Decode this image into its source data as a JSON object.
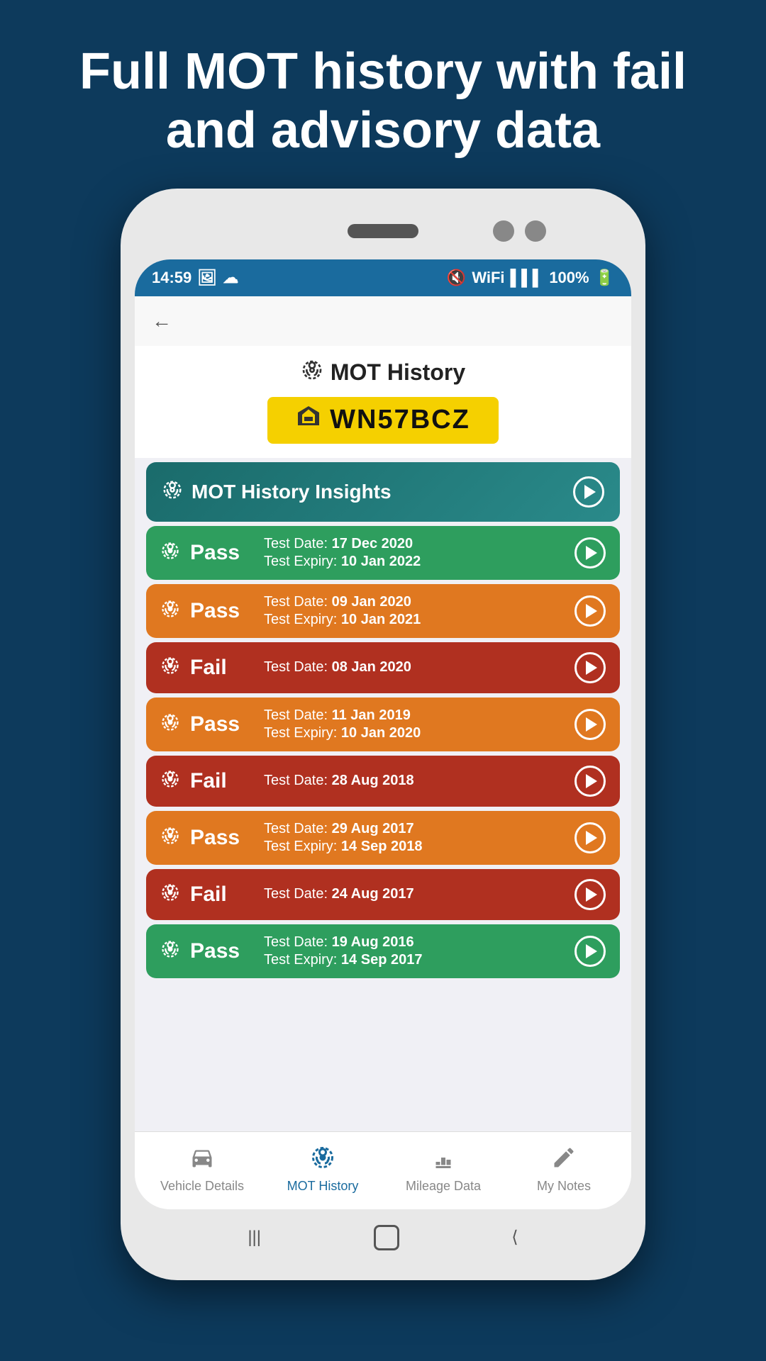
{
  "page": {
    "header": "Full MOT history with fail and advisory data"
  },
  "status_bar": {
    "time": "14:59",
    "battery": "100%"
  },
  "mot_title": "MOT History",
  "license_plate": "WN57BCZ",
  "insights": {
    "label": "MOT History Insights"
  },
  "records": [
    {
      "type": "Pass",
      "color_class": "pass-green",
      "test_date_label": "Test Date:",
      "test_date": "17 Dec 2020",
      "expiry_label": "Test Expiry:",
      "expiry": "10 Jan 2022",
      "has_expiry": true
    },
    {
      "type": "Pass",
      "color_class": "pass-orange",
      "test_date_label": "Test Date:",
      "test_date": "09 Jan 2020",
      "expiry_label": "Test Expiry:",
      "expiry": "10 Jan 2021",
      "has_expiry": true
    },
    {
      "type": "Fail",
      "color_class": "fail-red",
      "test_date_label": "Test Date:",
      "test_date": "08 Jan 2020",
      "has_expiry": false
    },
    {
      "type": "Pass",
      "color_class": "pass-orange",
      "test_date_label": "Test Date:",
      "test_date": "11 Jan 2019",
      "expiry_label": "Test Expiry:",
      "expiry": "10 Jan 2020",
      "has_expiry": true
    },
    {
      "type": "Fail",
      "color_class": "fail-red",
      "test_date_label": "Test Date:",
      "test_date": "28 Aug 2018",
      "has_expiry": false
    },
    {
      "type": "Pass",
      "color_class": "pass-orange",
      "test_date_label": "Test Date:",
      "test_date": "29 Aug 2017",
      "expiry_label": "Test Expiry:",
      "expiry": "14 Sep 2018",
      "has_expiry": true
    },
    {
      "type": "Fail",
      "color_class": "fail-red",
      "test_date_label": "Test Date:",
      "test_date": "24 Aug 2017",
      "has_expiry": false
    },
    {
      "type": "Pass",
      "color_class": "pass-green",
      "test_date_label": "Test Date:",
      "test_date": "19 Aug 2016",
      "expiry_label": "Test Expiry:",
      "expiry": "14 Sep 2017",
      "has_expiry": true
    }
  ],
  "bottom_nav": {
    "items": [
      {
        "label": "Vehicle Details",
        "active": false
      },
      {
        "label": "MOT History",
        "active": true
      },
      {
        "label": "Mileage Data",
        "active": false
      },
      {
        "label": "My Notes",
        "active": false
      }
    ]
  }
}
